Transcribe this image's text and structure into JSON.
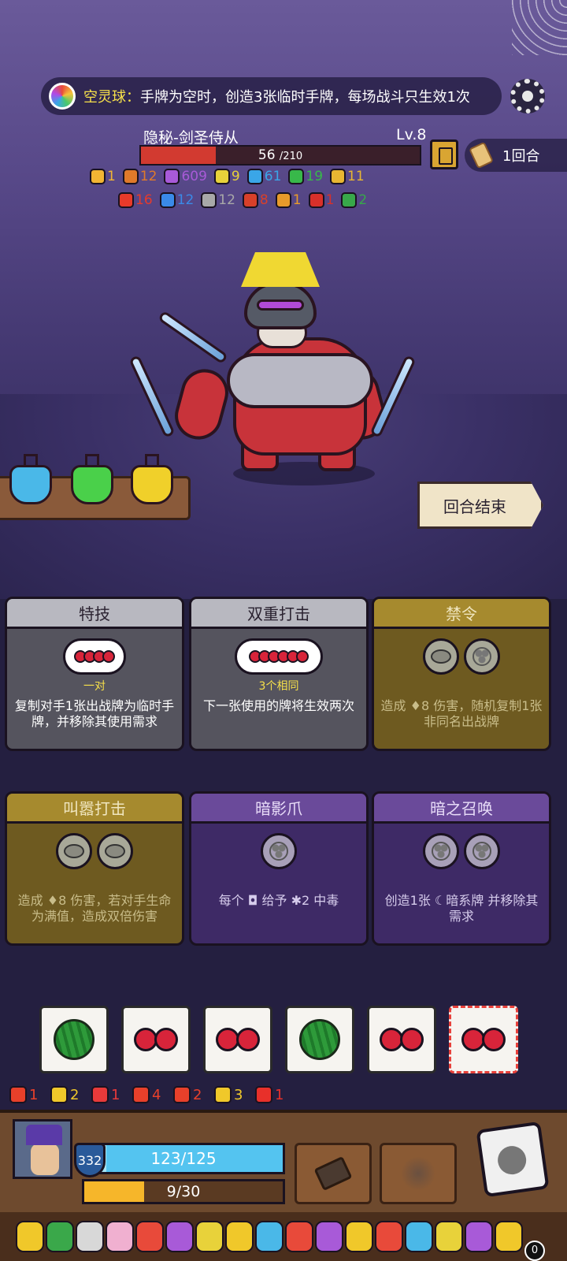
{
  "relic_banner": {
    "name": "空灵球：",
    "text": "手牌为空时，创造3张临时手牌，每场战斗只生效1次"
  },
  "enemy": {
    "name": "隐秘-剑圣侍从",
    "level": "Lv.8",
    "hp_current": "56",
    "hp_max": "/210",
    "hp_fraction": 0.267,
    "status_row1": [
      {
        "icon": "shield-badge-icon",
        "color": "#f2b533",
        "value": "1"
      },
      {
        "icon": "flame-icon",
        "color": "#e07a2a",
        "value": "12"
      },
      {
        "icon": "purple-splat-icon",
        "color": "#a85ad8",
        "value": "609"
      },
      {
        "icon": "triangle-icon",
        "color": "#e8d23a",
        "value": "9"
      },
      {
        "icon": "snowflake-icon",
        "color": "#3aa6e8",
        "value": "61"
      },
      {
        "icon": "green-swirl-icon",
        "color": "#38b84a",
        "value": "19"
      },
      {
        "icon": "lock-icon",
        "color": "#e8b632",
        "value": "11"
      }
    ],
    "status_row2": [
      {
        "icon": "fire-icon",
        "color": "#e83a2a",
        "value": "16"
      },
      {
        "icon": "blue-skull-icon",
        "color": "#3a8ae8",
        "value": "12"
      },
      {
        "icon": "gray-skull-icon",
        "color": "#a8a8a8",
        "value": "12"
      },
      {
        "icon": "red-flame-icon",
        "color": "#d8402a",
        "value": "8"
      },
      {
        "icon": "orange-claw-icon",
        "color": "#e89a2a",
        "value": "1"
      },
      {
        "icon": "red-hook-icon",
        "color": "#d8302a",
        "value": "1"
      },
      {
        "icon": "green-gear-icon",
        "color": "#38a84a",
        "value": "2"
      }
    ]
  },
  "round": {
    "label": "1回合"
  },
  "end_turn": {
    "label": "回合结束"
  },
  "potions": [
    {
      "name": "blue-potion",
      "color": "#4ab8e8"
    },
    {
      "name": "green-potion",
      "color": "#4ad04a"
    },
    {
      "name": "yellow-potion",
      "color": "#f0d02a"
    }
  ],
  "skills": [
    {
      "title": "特技",
      "theme": "gray",
      "slots": [
        "cherry-pair"
      ],
      "tag": "一对",
      "desc": "复制对手1张出战牌为临时手牌，并移除其使用需求"
    },
    {
      "title": "双重打击",
      "theme": "gray",
      "slots": [
        "cherry-triple"
      ],
      "tag": "3个相同",
      "desc": "下一张使用的牌将生效两次"
    },
    {
      "title": "禁令",
      "theme": "olive",
      "slots": [
        "lemon",
        "grape"
      ],
      "tag": "",
      "desc": "造成 ♦8 伤害，随机复制1张非同名出战牌"
    },
    {
      "title": "叫嚣打击",
      "theme": "olive",
      "slots": [
        "lemon",
        "lemon"
      ],
      "tag": "",
      "desc": "造成 ♦8 伤害，若对手生命为满值，造成双倍伤害"
    },
    {
      "title": "暗影爪",
      "theme": "purple",
      "slots": [
        "grape"
      ],
      "tag": "",
      "desc": "每个 ◘ 给予 ✱2 中毒"
    },
    {
      "title": "暗之召唤",
      "theme": "purple",
      "slots": [
        "grape",
        "grape"
      ],
      "tag": "",
      "desc": "创造1张 ☾暗系牌 并移除其需求"
    }
  ],
  "dice": [
    "watermelon",
    "cherry",
    "cherry",
    "watermelon",
    "cherry",
    "cherry"
  ],
  "player_status": [
    {
      "icon": "red-gear-icon",
      "color": "#e8402a",
      "value": "1"
    },
    {
      "icon": "yellow-star-icon",
      "color": "#f0c82a",
      "value": "2"
    },
    {
      "icon": "red-shield-icon",
      "color": "#e83a3a",
      "value": "1"
    },
    {
      "icon": "red-spiral-icon",
      "color": "#e8402a",
      "value": "4"
    },
    {
      "icon": "red-shield-check-icon",
      "color": "#e8402a",
      "value": "2"
    },
    {
      "icon": "yellow-chevron-icon",
      "color": "#f0c82a",
      "value": "3"
    },
    {
      "icon": "red-hook-icon",
      "color": "#e8302a",
      "value": "1"
    }
  ],
  "player": {
    "armor": "332",
    "hp": "123/125",
    "hp_fraction": 0.984,
    "energy": "9/30",
    "energy_fraction": 0.3
  },
  "relic_colors": [
    "#f0c82a",
    "#3aa84a",
    "#d8d8d8",
    "#f0b0d0",
    "#e84a3a",
    "#a85ad8",
    "#e8d23a",
    "#f0c82a",
    "#4ab8e8",
    "#e84a3a",
    "#a85ad8",
    "#f0c82a",
    "#e84a3a",
    "#4ab8e8",
    "#e8d23a",
    "#a85ad8",
    "#f0c82a"
  ],
  "relic_count": "0"
}
